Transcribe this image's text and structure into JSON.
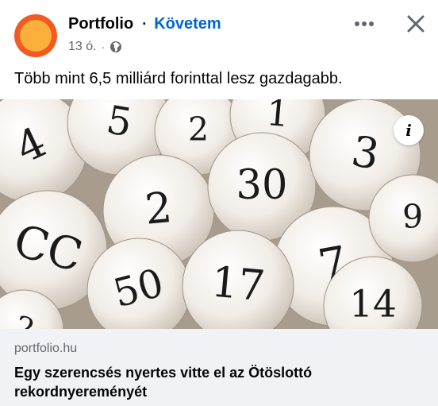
{
  "post": {
    "page_name": "Portfolio",
    "separator": "·",
    "follow_label": "Követem",
    "time": "13 ó.",
    "meta_separator": "·",
    "privacy_icon": "globe-icon",
    "text": "Több mint 6,5 milliárd forinttal lesz gazdagabb.",
    "more_icon": "more-options-icon",
    "close_icon": "close-icon"
  },
  "image": {
    "info_label": "i",
    "ball_numbers": [
      "4",
      "5",
      "2",
      "1",
      "CC",
      "2",
      "30",
      "3",
      "7",
      "9",
      "50",
      "17",
      "14",
      "2"
    ]
  },
  "link_preview": {
    "domain": "portfolio.hu",
    "headline": "Egy szerencsés nyertes vitte el az Ötöslottó rekordnyereményét"
  },
  "colors": {
    "accent": "#0064d1",
    "avatar_outer": "#f15a22",
    "avatar_inner": "#fbb03b",
    "secondary_text": "#65676b",
    "link_bg": "#f0f2f5"
  }
}
